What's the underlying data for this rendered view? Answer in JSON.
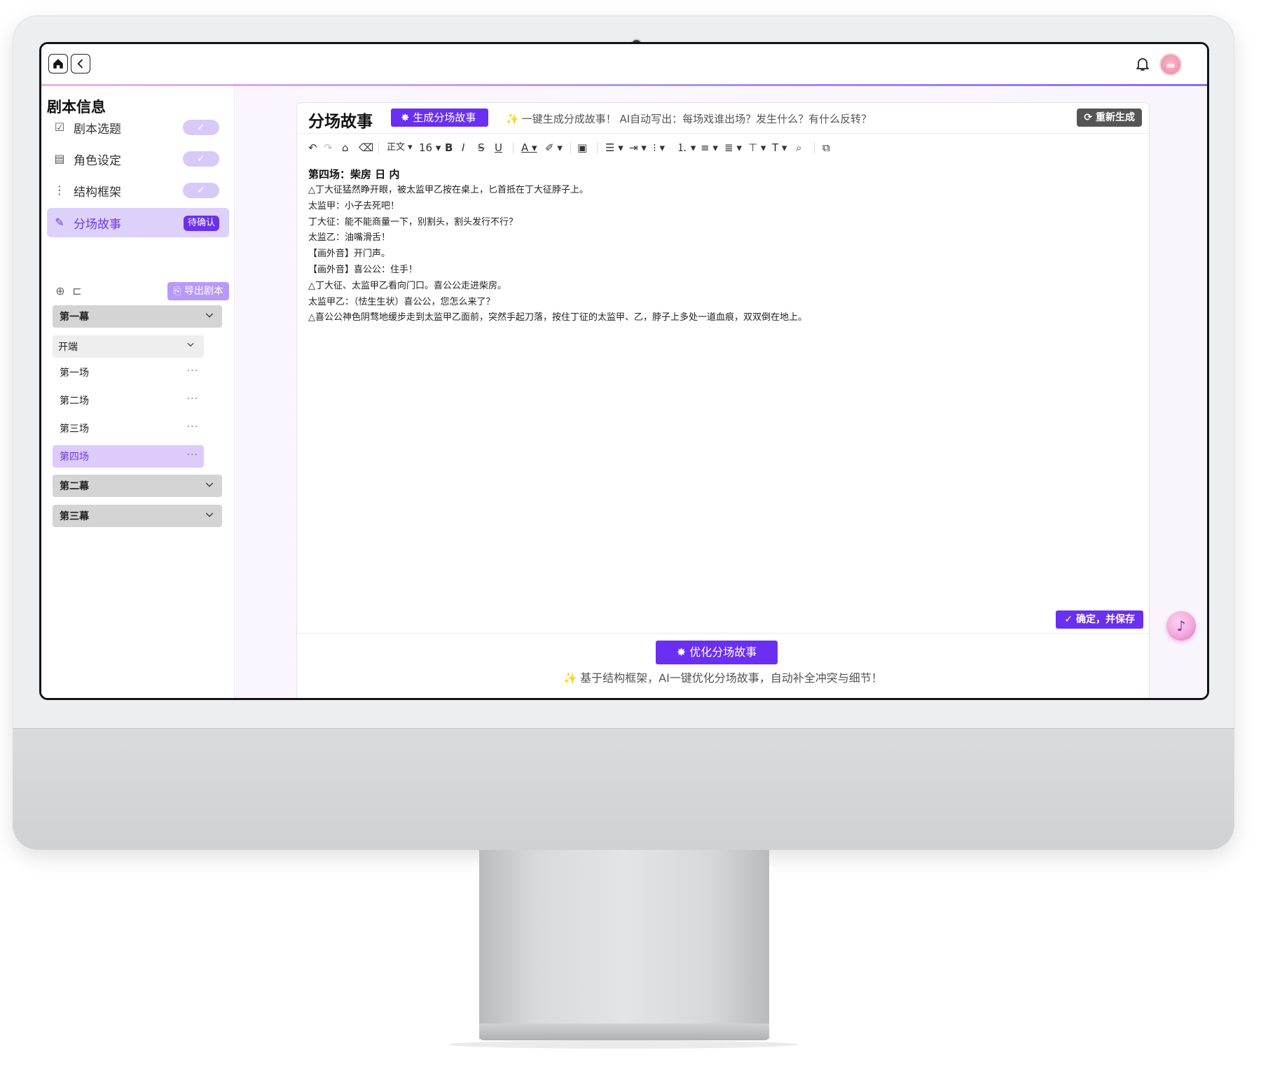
{
  "sidebar": {
    "title": "剧本信息",
    "steps": [
      {
        "label": "剧本选题",
        "status": "✓"
      },
      {
        "label": "角色设定",
        "status": "✓"
      },
      {
        "label": "结构框架",
        "status": "✓"
      },
      {
        "label": "分场故事",
        "status": "待确认"
      }
    ],
    "export_label": "导出剧本",
    "acts": [
      "第一幕",
      "第二幕",
      "第三幕"
    ],
    "part": "开端",
    "scenes": [
      "第一场",
      "第二场",
      "第三场",
      "第四场"
    ],
    "more": "···"
  },
  "editor": {
    "title": "分场故事",
    "generate_label": "生成分场故事",
    "hint": "一键生成分成故事！ AI自动写出：每场戏谁出场？发生什么？有什么反转？",
    "regenerate_label": "重新生成",
    "toolbar": {
      "paragraph": "正文",
      "font_size": "16"
    },
    "heading": "第四场：柴房  日 内",
    "lines": [
      "△丁大征猛然睁开眼，被太监甲乙按在桌上，匕首抵在丁大征脖子上。",
      "太监甲：小子去死吧！",
      "丁大征：能不能商量一下，别割头，割头发行不行？",
      "太监乙：油嘴滑舌！",
      "【画外音】开门声。",
      "【画外音】喜公公：住手！",
      "△丁大征、太监甲乙看向门口。喜公公走进柴房。",
      "太监甲乙：（怯生生状）喜公公，您怎么来了？",
      "△喜公公神色阴骛地缓步走到太监甲乙面前，突然手起刀落，按住丁征的太监甲、乙，脖子上多处一道血痕，双双倒在地上。"
    ],
    "save_label": "确定，并保存",
    "optimize_label": "优化分场故事",
    "optimize_hint": "基于结构框架，AI一键优化分场故事，自动补全冲突与细节！"
  },
  "icons": {
    "home": "home-icon",
    "back": "chevron-left-icon",
    "bell": "bell-icon",
    "avatar": "avatar",
    "assistant": "assistant-icon"
  },
  "colors": {
    "accent": "#6a2ff0",
    "accent_light": "#ddd1fb",
    "check_pill": "#d8c9fb"
  }
}
